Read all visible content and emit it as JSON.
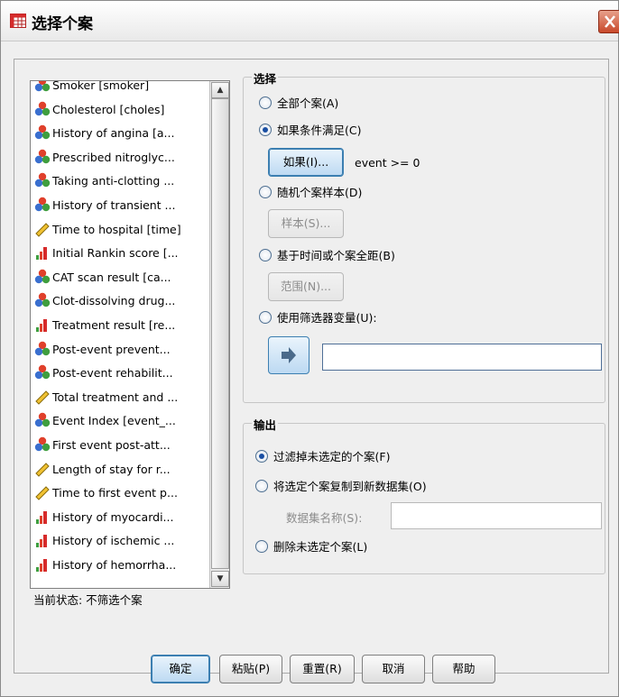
{
  "window": {
    "title": "选择个案"
  },
  "variables": [
    {
      "label": "Smoker [smoker]",
      "icon": "nominal-icon"
    },
    {
      "label": "Cholesterol [choles]",
      "icon": "nominal-icon"
    },
    {
      "label": "History of angina [a...",
      "icon": "nominal-icon"
    },
    {
      "label": "Prescribed nitroglyc...",
      "icon": "nominal-icon"
    },
    {
      "label": "Taking anti-clotting ...",
      "icon": "nominal-icon"
    },
    {
      "label": "History of transient ...",
      "icon": "nominal-icon"
    },
    {
      "label": "Time to hospital [time]",
      "icon": "scale-icon"
    },
    {
      "label": "Initial Rankin score [...",
      "icon": "ordinal-icon"
    },
    {
      "label": "CAT scan result [ca...",
      "icon": "nominal-icon"
    },
    {
      "label": "Clot-dissolving drug...",
      "icon": "nominal-icon"
    },
    {
      "label": "Treatment result [re...",
      "icon": "ordinal-icon"
    },
    {
      "label": "Post-event prevent...",
      "icon": "nominal-icon"
    },
    {
      "label": "Post-event rehabilit...",
      "icon": "nominal-icon"
    },
    {
      "label": "Total treatment and ...",
      "icon": "scale-icon"
    },
    {
      "label": "Event Index [event_...",
      "icon": "nominal-icon"
    },
    {
      "label": "First event post-att...",
      "icon": "nominal-icon"
    },
    {
      "label": "Length of stay for r...",
      "icon": "scale-icon"
    },
    {
      "label": "Time to first event p...",
      "icon": "scale-icon"
    },
    {
      "label": "History of myocardi...",
      "icon": "ordinal-icon"
    },
    {
      "label": "History of ischemic ...",
      "icon": "ordinal-icon"
    },
    {
      "label": "History of hemorrha...",
      "icon": "ordinal-icon"
    }
  ],
  "status": "当前状态: 不筛选个案",
  "select": {
    "title": "选择",
    "all_cases": "全部个案(A)",
    "if_condition": "如果条件满足(C)",
    "if_button": "如果(I)...",
    "condition_expr": "event >= 0",
    "random_sample": "随机个案样本(D)",
    "sample_button": "样本(S)...",
    "time_range": "基于时间或个案全距(B)",
    "range_button": "范围(N)...",
    "filter_var": "使用筛选器变量(U):",
    "selected": "if_condition"
  },
  "output": {
    "title": "输出",
    "filter_out": "过滤掉未选定的个案(F)",
    "copy_to_dataset": "将选定个案复制到新数据集(O)",
    "dataset_name_label": "数据集名称(S):",
    "delete_unselected": "删除未选定个案(L)",
    "selected": "filter_out"
  },
  "buttons": {
    "ok": "确定",
    "paste": "粘贴(P)",
    "reset": "重置(R)",
    "cancel": "取消",
    "help": "帮助"
  },
  "colors": {
    "accent": "#3c7fb1",
    "close_button": "#c8482a"
  }
}
